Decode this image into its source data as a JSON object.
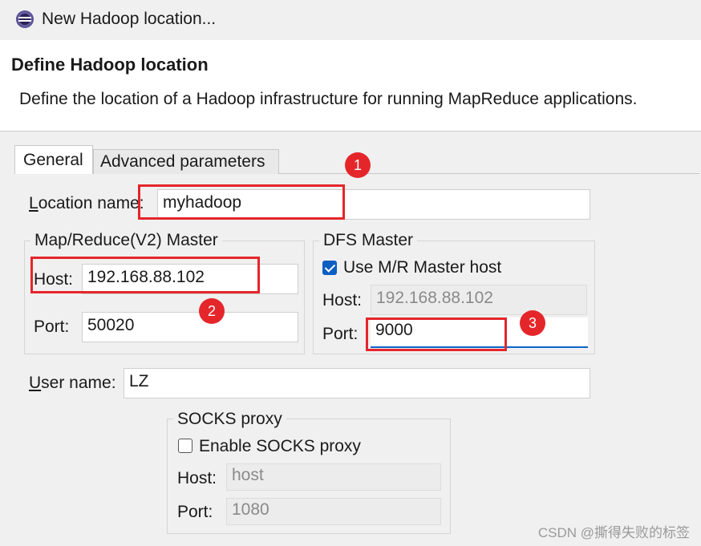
{
  "window": {
    "title": "New Hadoop location..."
  },
  "header": {
    "title": "Define Hadoop location",
    "description": "Define the location of a Hadoop infrastructure for running MapReduce applications."
  },
  "tabs": [
    {
      "label": "General",
      "active": true
    },
    {
      "label": "Advanced parameters",
      "active": false
    }
  ],
  "location": {
    "label_first": "L",
    "label_rest": "ocation name:",
    "value": "myhadoop"
  },
  "mr_master": {
    "legend": "Map/Reduce(V2) Master",
    "host_label": "Host:",
    "host_value": "192.168.88.102",
    "port_label": "Port:",
    "port_value": "50020"
  },
  "dfs_master": {
    "legend": "DFS Master",
    "use_mr_label": "Use M/R Master host",
    "use_mr_checked": true,
    "host_label": "Host:",
    "host_value": "192.168.88.102",
    "port_label": "Port:",
    "port_value": "9000"
  },
  "user": {
    "label_first": "U",
    "label_rest": "ser name:",
    "value": "LZ"
  },
  "socks": {
    "legend": "SOCKS proxy",
    "enable_label": "Enable SOCKS proxy",
    "enable_checked": false,
    "host_label": "Host:",
    "host_value": "host",
    "port_label": "Port:",
    "port_value": "1080"
  },
  "annotations": {
    "marker1": "1",
    "marker2": "2",
    "marker3": "3",
    "color": "#e4262b"
  },
  "watermark": "CSDN @撕得失败的标签",
  "colors": {
    "accent": "#0b5fc2"
  }
}
